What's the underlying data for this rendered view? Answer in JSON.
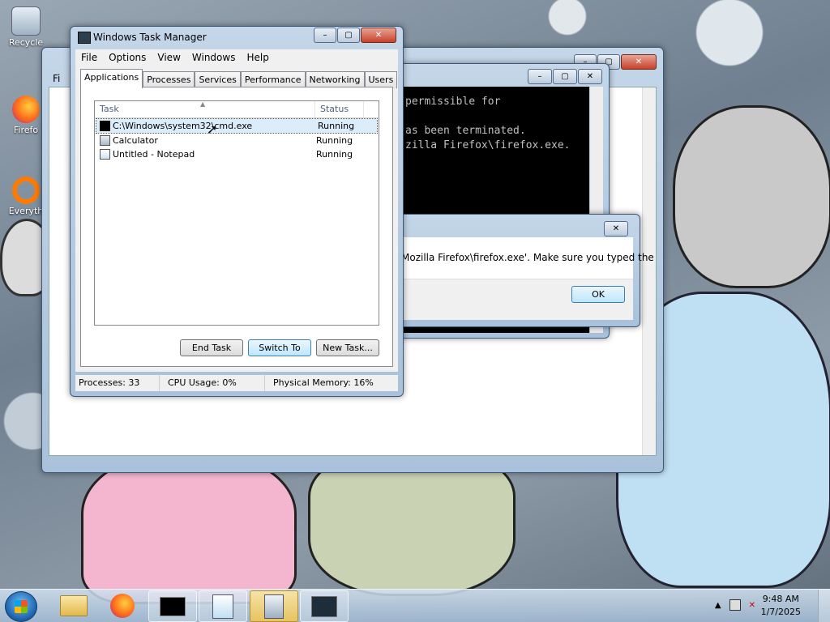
{
  "desktop": {
    "icons": [
      {
        "label": "Recycle"
      },
      {
        "label": "Firefo"
      },
      {
        "label": "Everyth"
      }
    ]
  },
  "back_window": {
    "menu_fragment": "Fi"
  },
  "cmd": {
    "lines": [
      "permissible for",
      "",
      "as been terminated.",
      "zilla Firefox\\firefox.exe."
    ]
  },
  "error_dialog": {
    "message": "Mozilla Firefox\\firefox.exe'. Make sure you typed the",
    "ok_label": "OK",
    "close_glyph": "✕"
  },
  "task_manager": {
    "title": "Windows Task Manager",
    "menu": [
      "File",
      "Options",
      "View",
      "Windows",
      "Help"
    ],
    "tabs": [
      "Applications",
      "Processes",
      "Services",
      "Performance",
      "Networking",
      "Users"
    ],
    "columns": {
      "task": "Task",
      "status": "Status"
    },
    "rows": [
      {
        "task": "C:\\Windows\\system32\\cmd.exe",
        "status": "Running"
      },
      {
        "task": "Calculator",
        "status": "Running"
      },
      {
        "task": "Untitled - Notepad",
        "status": "Running"
      }
    ],
    "buttons": {
      "end_task": "End Task",
      "switch_to": "Switch To",
      "new_task": "New Task..."
    },
    "status_bar": {
      "processes": "Processes: 33",
      "cpu": "CPU Usage: 0%",
      "memory": "Physical Memory: 16%"
    }
  },
  "taskbar": {
    "time": "9:48 AM",
    "date": "1/7/2025"
  }
}
